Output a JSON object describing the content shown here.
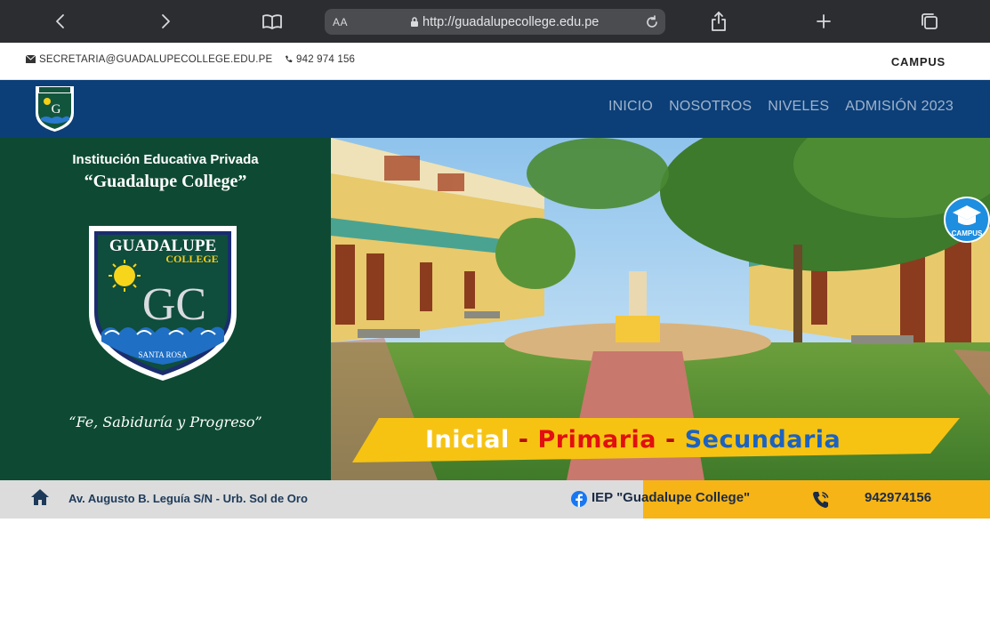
{
  "browser": {
    "text_size_button": "AA",
    "url": "http://guadalupecollege.edu.pe",
    "icons": [
      "back-icon",
      "forward-icon",
      "bookmarks-icon",
      "lock-icon",
      "reload-icon",
      "share-icon",
      "new-tab-icon",
      "tabs-icon"
    ]
  },
  "topbar": {
    "email": "SECRETARIA@GUADALUPECOLLEGE.EDU.PE",
    "phone": "942 974 156",
    "campus": "CAMPUS"
  },
  "nav": {
    "items": [
      "INICIO",
      "NOSOTROS",
      "NIVELES",
      "ADMISIÓN 2023"
    ]
  },
  "hero": {
    "institution": "Institución Educativa Privada",
    "school_name": "“Guadalupe College”",
    "crest": {
      "name": "GUADALUPE",
      "subtitle": "COLLEGE",
      "initials": "GC",
      "location": "SANTA ROSA"
    },
    "motto": "“Fe, Sabiduría y Progreso”",
    "levels": {
      "inicial": "Inicial",
      "separator": "-",
      "primaria": "Primaria",
      "secundaria": "Secundaria"
    },
    "campus_badge": "CAMPUS"
  },
  "footer_strip": {
    "address": "Av. Augusto B. Leguía S/N  - Urb. Sol de Oro",
    "facebook": "IEP \"Guadalupe College\"",
    "phone": "942974156"
  },
  "colors": {
    "navbar": "#0c3f78",
    "hero_left": "#0e4a33",
    "accent_yellow": "#f6b417",
    "primaria_red": "#e10f0f",
    "secundaria_blue": "#1b62c2"
  }
}
